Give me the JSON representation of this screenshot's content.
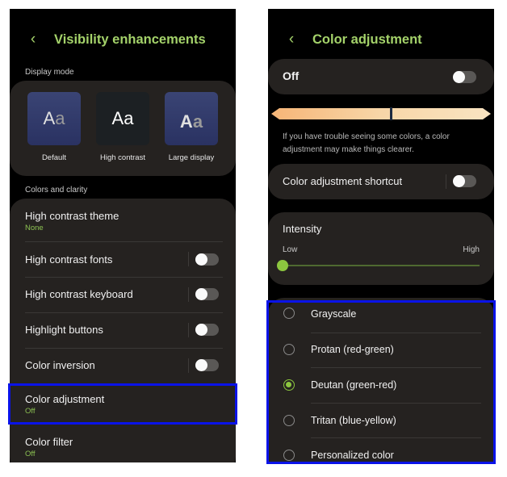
{
  "left_screen": {
    "header": {
      "back_icon": "chevron-left-icon",
      "title": "Visibility enhancements"
    },
    "display_mode": {
      "section_label": "Display mode",
      "options": [
        {
          "glyph": "Aa",
          "label": "Default"
        },
        {
          "glyph": "Aa",
          "label": "High contrast"
        },
        {
          "glyph": "Aa",
          "label": "Large display"
        }
      ]
    },
    "colors_and_clarity": {
      "section_label": "Colors and clarity",
      "items": [
        {
          "label": "High contrast theme",
          "sub": "None"
        },
        {
          "label": "High contrast fonts",
          "toggle": false
        },
        {
          "label": "High contrast keyboard",
          "toggle": false
        },
        {
          "label": "Highlight buttons",
          "toggle": false
        },
        {
          "label": "Color inversion",
          "toggle": false
        },
        {
          "label": "Color adjustment",
          "sub": "Off",
          "highlighted": true
        },
        {
          "label": "Color filter",
          "sub": "Off"
        }
      ]
    }
  },
  "right_screen": {
    "header": {
      "back_icon": "chevron-left-icon",
      "title": "Color adjustment"
    },
    "master_switch": {
      "label": "Off",
      "toggle": false
    },
    "description": "If you have trouble seeing some colors, a color adjustment may make things clearer.",
    "shortcut": {
      "label": "Color adjustment shortcut",
      "toggle": false
    },
    "intensity": {
      "label": "Intensity",
      "low_label": "Low",
      "high_label": "High",
      "value_percent": 0
    },
    "modes": {
      "highlighted": true,
      "options": [
        {
          "label": "Grayscale",
          "selected": false
        },
        {
          "label": "Protan (red-green)",
          "selected": false
        },
        {
          "label": "Deutan (green-red)",
          "selected": true
        },
        {
          "label": "Tritan (blue-yellow)",
          "selected": false
        },
        {
          "label": "Personalized color",
          "selected": false
        }
      ]
    }
  },
  "colors": {
    "accent": "#a4d26a",
    "selected_green": "#8cc63f",
    "highlight_border": "#0a13e8",
    "card_bg": "#252220",
    "screen_bg": "#000000"
  }
}
